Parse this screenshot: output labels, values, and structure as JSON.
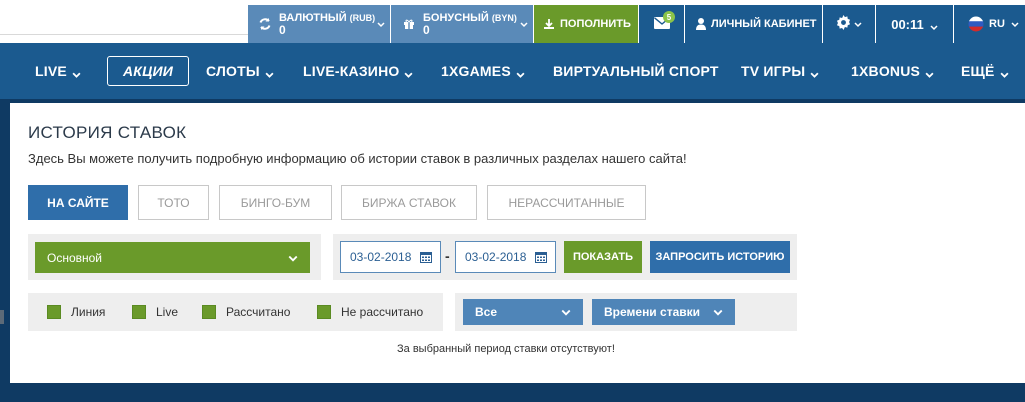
{
  "topbar": {
    "currency_account": {
      "label": "ВАЛЮТНЫЙ",
      "unit": "(RUB)",
      "value": "0"
    },
    "bonus_account": {
      "label": "БОНУСНЫЙ",
      "unit": "(BYN)",
      "value": "0"
    },
    "deposit_label": "ПОПОЛНИТЬ",
    "messages_count": "5",
    "cabinet_label": "ЛИЧНЫЙ КАБИНЕТ",
    "time": "00:11",
    "lang": "RU"
  },
  "nav": {
    "items": [
      {
        "label": "LIVE"
      },
      {
        "label": "АКЦИИ"
      },
      {
        "label": "СЛОТЫ"
      },
      {
        "label": "LIVE-КАЗИНО"
      },
      {
        "label": "1XGAMES"
      },
      {
        "label": "ВИРТУАЛЬНЫЙ СПОРТ"
      },
      {
        "label": "TV ИГРЫ"
      },
      {
        "label": "1XBONUS"
      },
      {
        "label": "ЕЩЁ"
      }
    ]
  },
  "page": {
    "title": "ИСТОРИЯ СТАВОК",
    "description": "Здесь Вы можете получить подробную информацию об истории ставок в различных разделах нашего сайта!",
    "tabs": [
      {
        "label": "НА САЙТЕ"
      },
      {
        "label": "ТОТО"
      },
      {
        "label": "БИНГО-БУМ"
      },
      {
        "label": "БИРЖА СТАВОК"
      },
      {
        "label": "НЕРАССЧИТАННЫЕ"
      }
    ],
    "account_select": "Основной",
    "date_from": "03-02-2018",
    "date_separator": "-",
    "date_to": "03-02-2018",
    "show_button": "ПОКАЗАТЬ",
    "request_button": "ЗАПРОСИТЬ ИСТОРИЮ",
    "checkboxes": [
      {
        "label": "Линия"
      },
      {
        "label": "Live"
      },
      {
        "label": "Рассчитано"
      },
      {
        "label": "Не рассчитано"
      }
    ],
    "status_select": "Все",
    "sort_select": "Времени ставки",
    "empty_message": "За выбранный период ставки отсутствуют!"
  },
  "colors": {
    "accent_blue": "#2f6eaa",
    "nav_blue": "#1b5a8f",
    "green": "#6a9a2a"
  }
}
